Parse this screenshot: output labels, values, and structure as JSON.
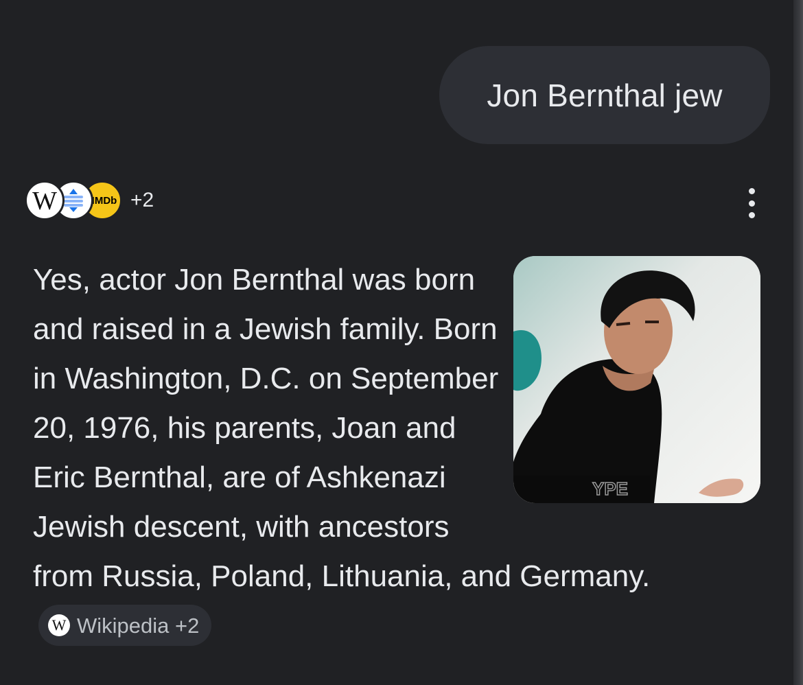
{
  "query": {
    "text": "Jon Bernthal jew"
  },
  "sources": {
    "icons": [
      "wikipedia-icon",
      "arrows-icon",
      "imdb-icon"
    ],
    "wiki_letter": "W",
    "imdb_label": "IMDb",
    "more_count": "+2"
  },
  "answer": {
    "text": "Yes, actor Jon Bernthal was born and raised in a Jewish family. Born in Washington, D.C. on September 20, 1976, his parents, Joan and Eric Bernthal, are of Ashkenazi Jewish descent, with ancestors from Russia, Poland, Lithuania, and Germany.",
    "image_watermark": "YPE",
    "citation": {
      "icon_letter": "W",
      "label": "Wikipedia +2"
    }
  },
  "colors": {
    "background": "#202124",
    "bubble": "#2d2f35",
    "text": "#e8eaed",
    "chip_text": "#bdc1c6",
    "imdb_yellow": "#f5c518"
  }
}
